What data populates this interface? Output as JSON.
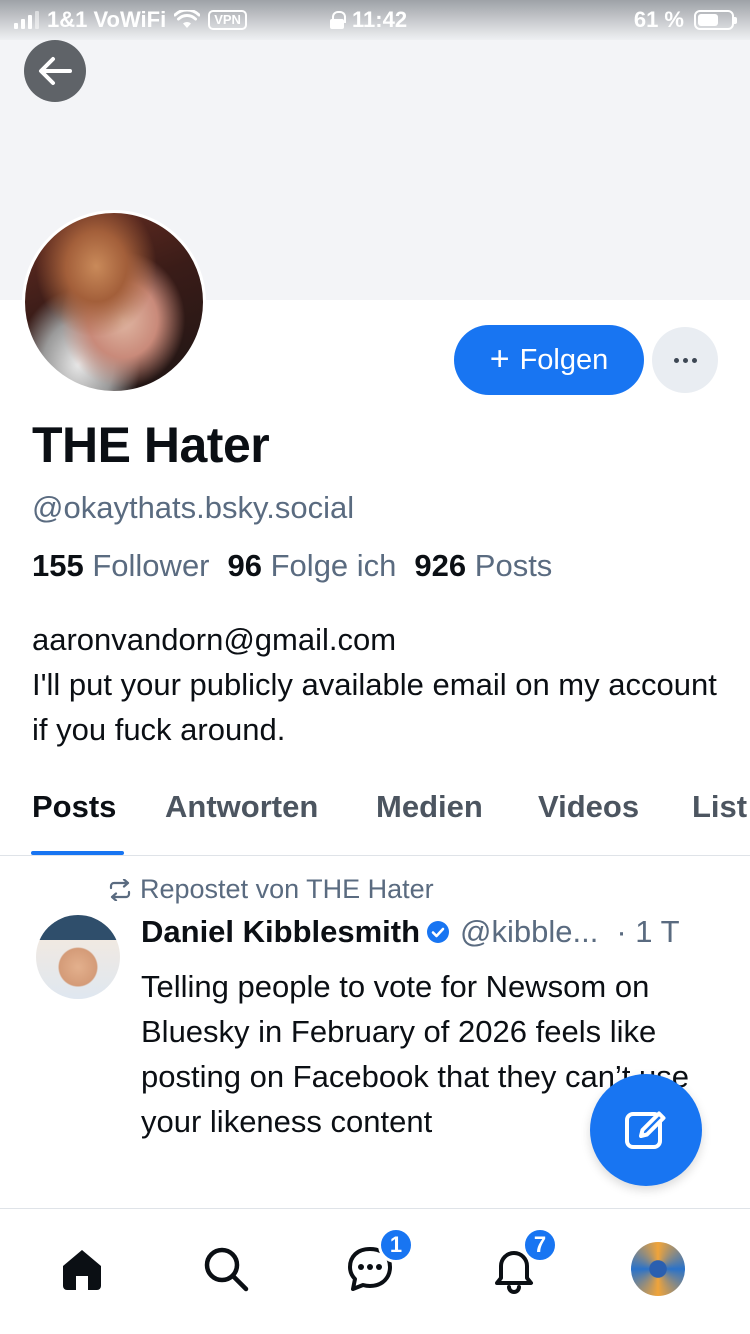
{
  "status_bar": {
    "carrier": "1&1 VoWiFi",
    "vpn": "VPN",
    "time": "11:42",
    "battery": "61 %",
    "battery_level": 0.61
  },
  "profile": {
    "display_name": "THE Hater",
    "handle": "@okaythats.bsky.social",
    "follow_label": "Folgen",
    "stats": {
      "followers_count": "155",
      "followers_label": "Follower",
      "following_count": "96",
      "following_label": "Folge ich",
      "posts_count": "926",
      "posts_label": "Posts"
    },
    "bio_line1": "aaronvandorn@gmail.com",
    "bio_line2": "I'll put your publicly available email on my account if you fuck around."
  },
  "tabs": [
    "Posts",
    "Antworten",
    "Medien",
    "Videos",
    "List"
  ],
  "active_tab": "Posts",
  "post": {
    "repost_label": "Repostet von THE Hater",
    "author": "Daniel Kibblesmith",
    "handle": "@kibble...",
    "time": "· 1 T",
    "text": "Telling people to vote for Newsom on Bluesky in February of 2026 feels like posting on Facebook that they can’t use your likeness content"
  },
  "nav": {
    "messages_badge": "1",
    "notifications_badge": "7",
    "icons": [
      "home-icon",
      "search-icon",
      "chat-icon",
      "bell-icon",
      "profile-avatar"
    ]
  },
  "colors": {
    "accent": "#1875f2",
    "muted_text": "#5a6b80"
  }
}
